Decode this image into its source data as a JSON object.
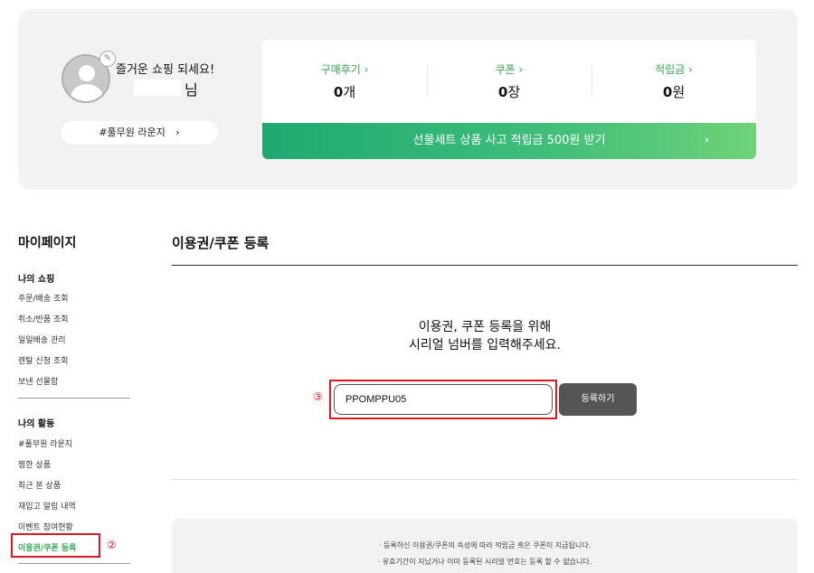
{
  "profile": {
    "greeting": "즐거운 쇼핑 되세요!",
    "name_suffix": "님",
    "lounge_label": "#풀무원 라운지",
    "lounge_arrow": "›"
  },
  "stats": [
    {
      "label": "구매후기 ›",
      "value": "0",
      "unit": "개"
    },
    {
      "label": "쿠폰 ›",
      "value": "0",
      "unit": "장"
    },
    {
      "label": "적립금 ›",
      "value": "0",
      "unit": "원"
    }
  ],
  "promo": {
    "text": "선물세트 상품 사고 적립금 500원 받기",
    "arrow": "›"
  },
  "sidebar": {
    "title": "마이페이지",
    "sections": [
      {
        "title": "나의 쇼핑",
        "items": [
          "주문/배송 조회",
          "취소/반품 조회",
          "일일배송 관리",
          "렌탈 신청 조회",
          "보낸 선물함"
        ]
      },
      {
        "title": "나의 활동",
        "items": [
          "#풀무원 라운지",
          "찜한 상품",
          "최근 본 상품",
          "재입고 알림 내역",
          "이벤트 참여현황",
          "이용권/쿠폰 등록"
        ]
      }
    ],
    "active_item": "이용권/쿠폰 등록"
  },
  "annotations": {
    "two": "②",
    "three": "③"
  },
  "main": {
    "title": "이용권/쿠폰 등록",
    "instruction_line1": "이용권, 쿠폰 등록을 위해",
    "instruction_line2": "시리얼 넘버를 입력해주세요.",
    "serial_value": "PPOMPPU05",
    "register_label": "등록하기",
    "notices": [
      "· 등록하신 이용권/쿠폰의 속성에 따라 적립금 혹은 쿠폰이 지급됩니다.",
      "· 유효기간이 지났거나 이미 등록된 시리얼 번호는 등록 할 수 없습니다."
    ]
  },
  "colors": {
    "accent": "#2fa84f",
    "highlight": "#e0191f",
    "button_dark": "#555555"
  }
}
